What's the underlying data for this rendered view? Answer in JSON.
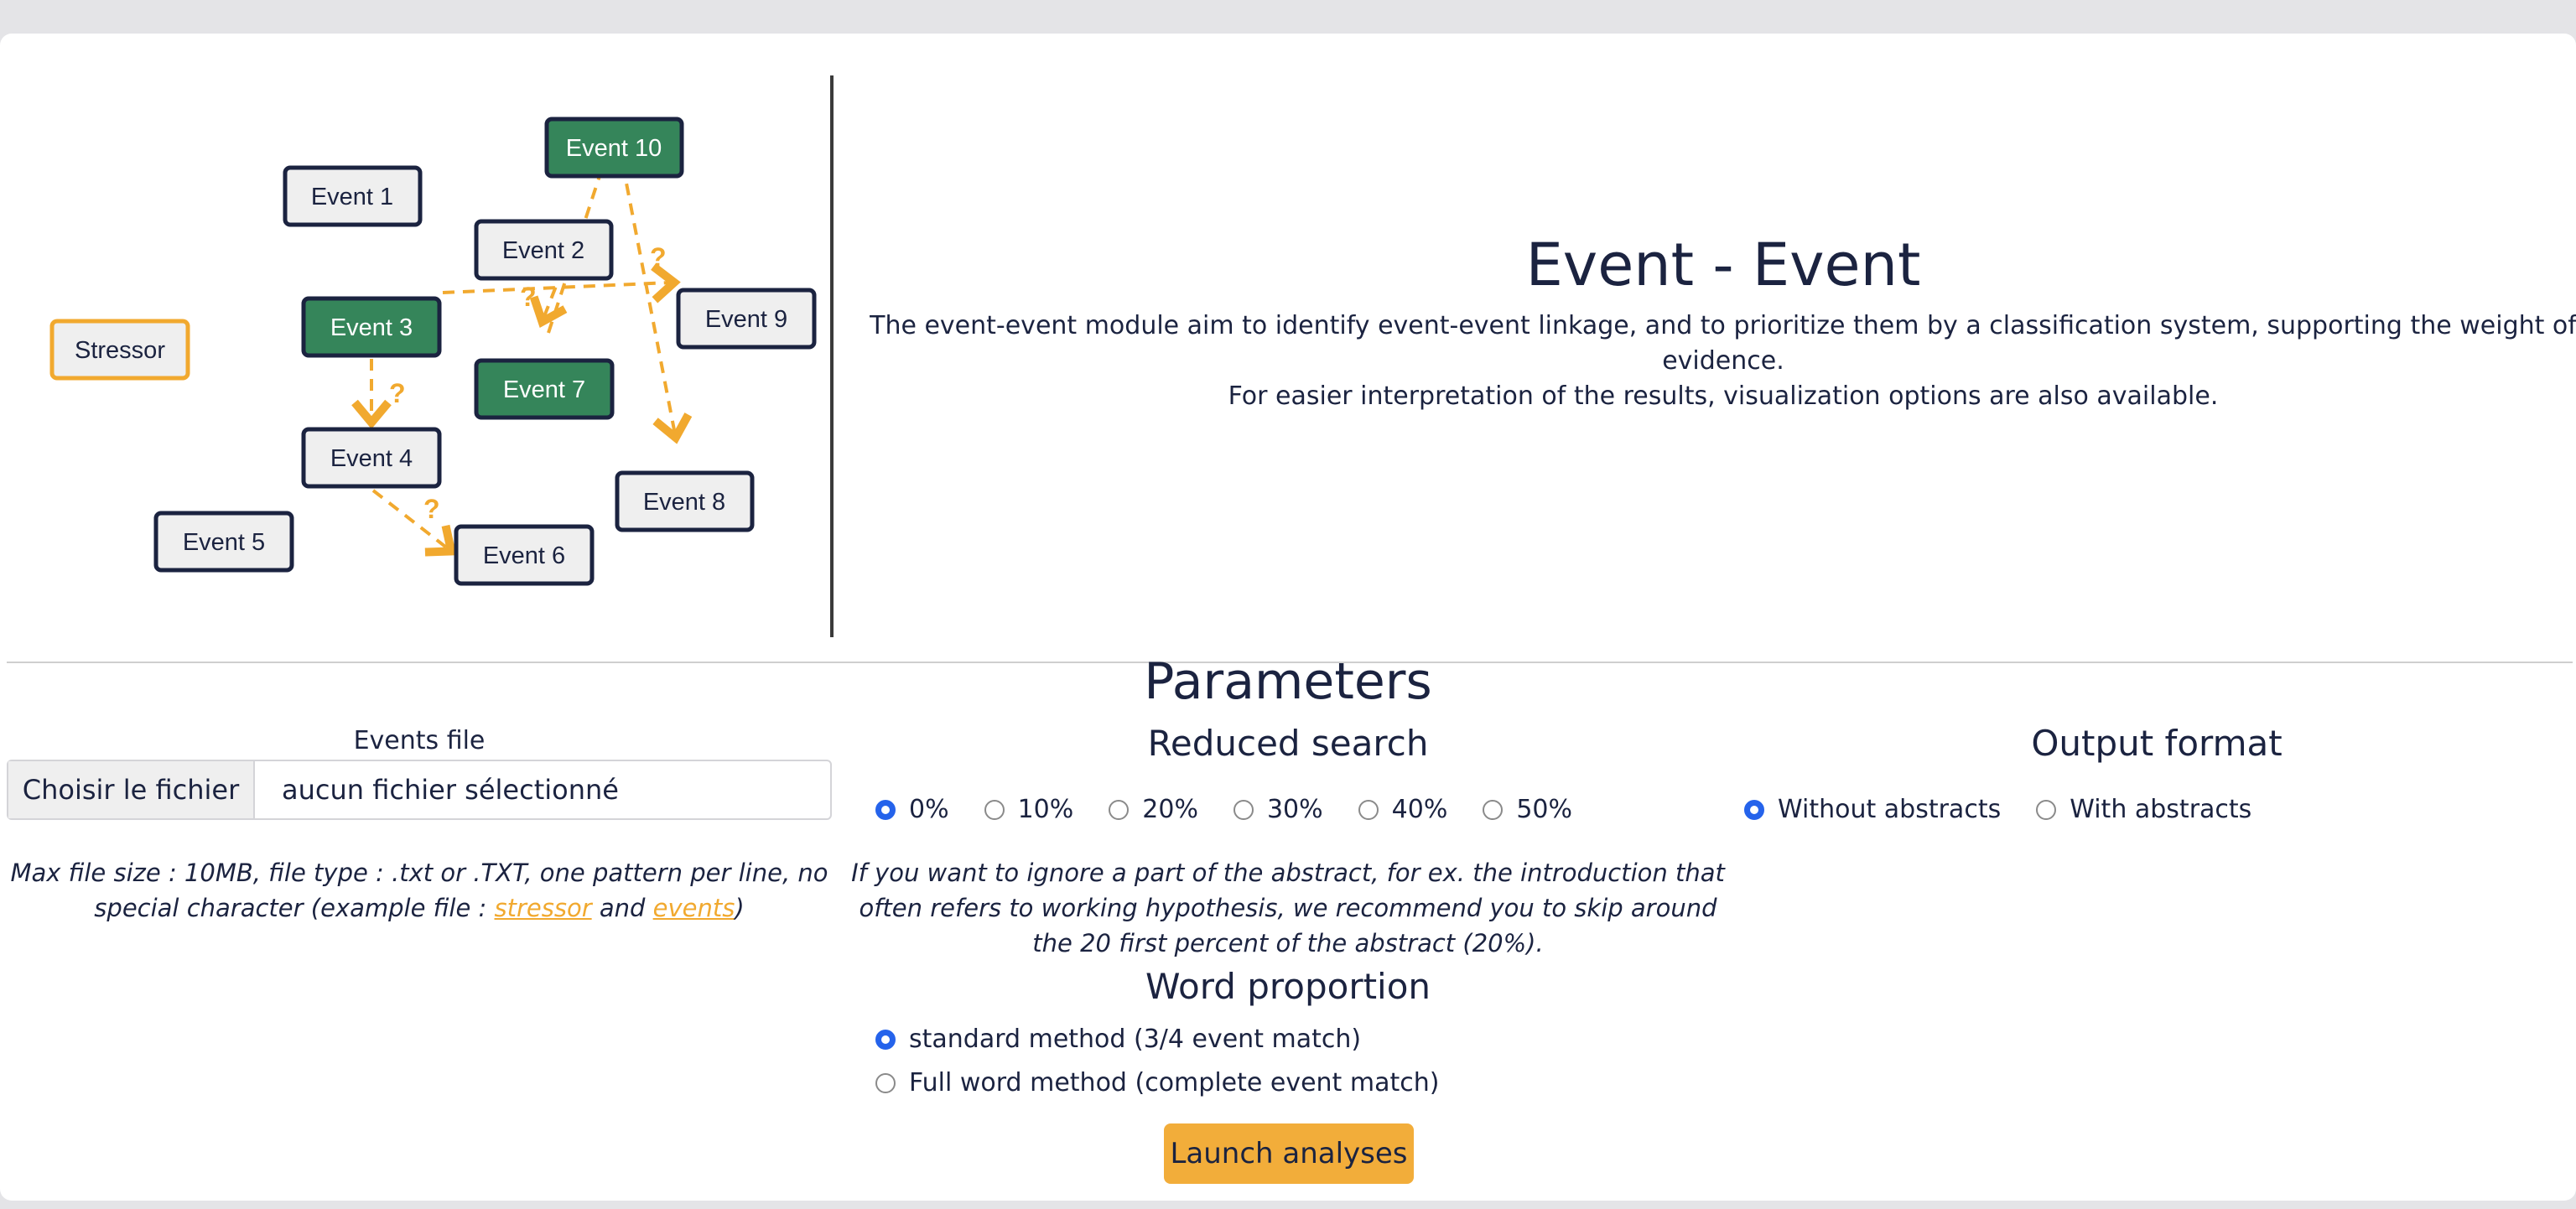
{
  "diagram": {
    "nodes": [
      {
        "label": "Event 10",
        "style": "green"
      },
      {
        "label": "Event 1",
        "style": "gray"
      },
      {
        "label": "Event 2",
        "style": "gray"
      },
      {
        "label": "Stressor",
        "style": "orange"
      },
      {
        "label": "Event 3",
        "style": "green"
      },
      {
        "label": "Event 9",
        "style": "gray"
      },
      {
        "label": "Event 7",
        "style": "green"
      },
      {
        "label": "Event 4",
        "style": "gray"
      },
      {
        "label": "Event 8",
        "style": "gray"
      },
      {
        "label": "Event 5",
        "style": "gray"
      },
      {
        "label": "Event 6",
        "style": "gray"
      }
    ],
    "question_mark": "?"
  },
  "header": {
    "title": "Event - Event",
    "description_line1": "The event-event module aim to identify event-event linkage, and to prioritize them by a classification system, supporting the weight of evidence.",
    "description_line2": "For easier interpretation of the results, visualization options are also available."
  },
  "parameters": {
    "title": "Parameters",
    "events_file": {
      "label": "Events file",
      "button_label": "Choisir le fichier",
      "file_name": "aucun fichier sélectionné",
      "note_line1": "Max file size : 10MB, file type : .txt or .TXT, one pattern per line, no",
      "note_line2_prefix": "special character (example file : ",
      "link_stressor": "stressor",
      "and_text": " and ",
      "link_events": "events",
      "note_line2_suffix": ")"
    },
    "reduced_search": {
      "title": "Reduced search",
      "options": [
        "0%",
        "10%",
        "20%",
        "30%",
        "40%",
        "50%"
      ],
      "selected": "0%",
      "note_line1": "If you want to ignore a part of the abstract, for ex. the introduction that",
      "note_line2": "often refers to working hypothesis, we recommend you to skip around",
      "note_line3": "the 20 first percent of the abstract (20%)."
    },
    "word_proportion": {
      "title": "Word proportion",
      "options": [
        "standard method (3/4 event match)",
        "Full word method (complete event match)"
      ],
      "selected": "standard method (3/4 event match)"
    },
    "output_format": {
      "title": "Output format",
      "options": [
        "Without abstracts",
        "With abstracts"
      ],
      "selected": "Without abstracts"
    },
    "launch_label": "Launch analyses"
  },
  "colors": {
    "accent": "#f2ad3a",
    "green_node": "#35855a",
    "radio_selected": "#2563eb",
    "arrow": "#f1a92f"
  }
}
